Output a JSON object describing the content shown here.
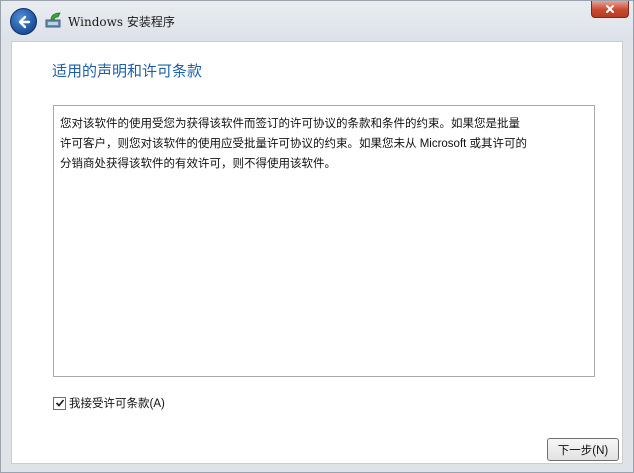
{
  "window": {
    "title": "Windows 安装程序"
  },
  "page": {
    "heading": "适用的声明和许可条款",
    "license_lines": [
      "您对该软件的使用受您为获得该软件而签订的许可协议的条款和条件的约束。如果您是批量",
      "许可客户，则您对该软件的使用应受批量许可协议的约束。如果您未从 Microsoft 或其许可的",
      "分销商处获得该软件的有效许可，则不得使用该软件。"
    ],
    "accept_label": "我接受许可条款(A)",
    "accept_checked": true,
    "next_label": "下一步(N)"
  },
  "colors": {
    "heading": "#1d5fa8",
    "back_button": "#1c4f9a",
    "close_button": "#c8492f"
  },
  "icons": {
    "back": "back-arrow-icon",
    "app": "setup-icon",
    "close": "close-icon",
    "check": "checkmark-icon"
  }
}
